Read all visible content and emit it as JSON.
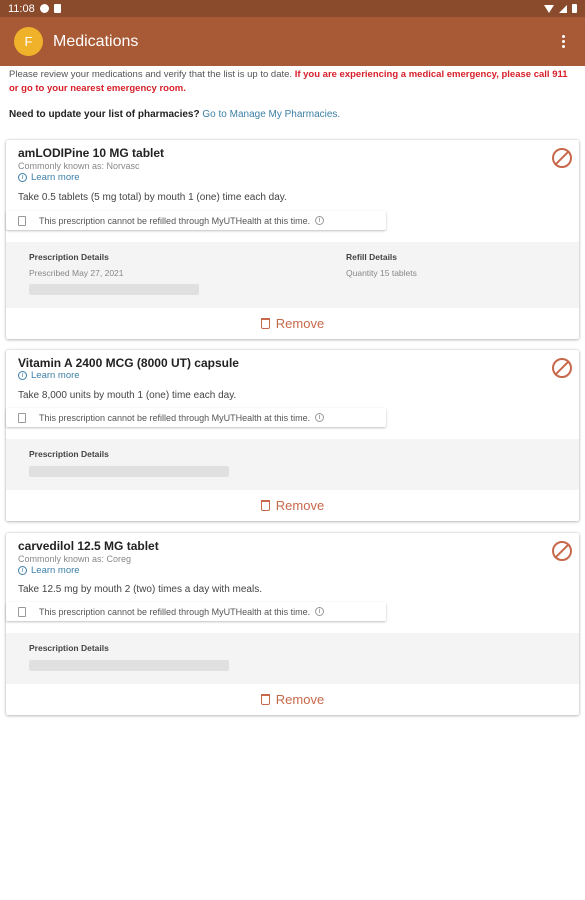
{
  "status_bar": {
    "time": "11:08"
  },
  "app_bar": {
    "avatar_letter": "F",
    "title": "Medications"
  },
  "intro": {
    "text": "Please review your medications and verify that the list is up to date.",
    "warning": "If you are experiencing a medical emergency, please call 911 or go to your nearest emergency room."
  },
  "pharmacy": {
    "question": "Need to update your list of pharmacies?",
    "link": "Go to Manage My Pharmacies."
  },
  "notice_text": "This prescription cannot be refilled through MyUTHealth at this time.",
  "learn_more": "Learn more",
  "remove_label": "Remove",
  "medications": [
    {
      "name": "amLODIPine 10 MG tablet",
      "known_as": "Commonly known as: Norvasc",
      "sig": "Take 0.5 tablets (5 mg total) by mouth 1 (one) time each day.",
      "rx_label": "Prescription Details",
      "prescribed": "Prescribed May 27, 2021",
      "refill_label": "Refill Details",
      "quantity": "Quantity 15 tablets"
    },
    {
      "name": "Vitamin A 2400 MCG (8000 UT) capsule",
      "sig": "Take 8,000 units by mouth 1 (one) time each day.",
      "rx_label": "Prescription Details"
    },
    {
      "name": "carvedilol 12.5 MG tablet",
      "known_as": "Commonly known as: Coreg",
      "sig": "Take 12.5 mg by mouth 2 (two) times a day with meals.",
      "rx_label": "Prescription Details"
    }
  ]
}
